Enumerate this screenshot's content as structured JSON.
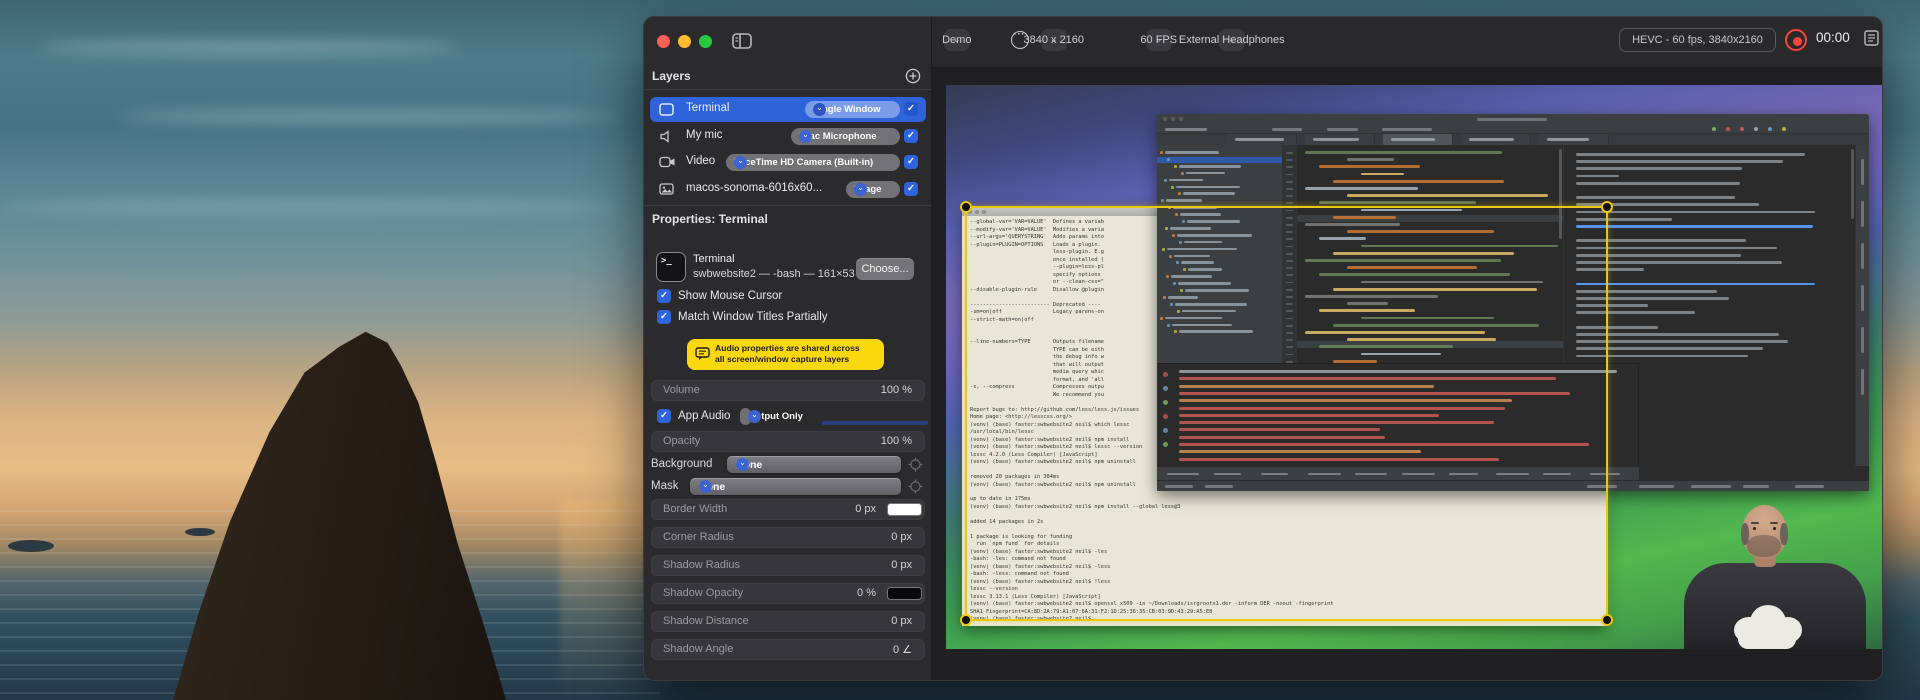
{
  "toolbar": {
    "preset": "Demo",
    "resolution": "3840 x 2160",
    "framerate": "60 FPS",
    "audio_device": "External Headphones",
    "format_info": "HEVC - 60 fps, 3840x2160",
    "timer": "00:00"
  },
  "layers_panel": {
    "title": "Layers",
    "rows": [
      {
        "name": "Terminal",
        "source": "Single Window",
        "icon": "window-icon",
        "selected": true,
        "enabled": true
      },
      {
        "name": "My mic",
        "source": "iMac Microphone",
        "icon": "speaker-icon",
        "selected": false,
        "enabled": true
      },
      {
        "name": "Video",
        "source": "FaceTime HD Camera (Built-in)",
        "icon": "camera-icon",
        "selected": false,
        "enabled": true
      },
      {
        "name": "macos-sonoma-6016x60...",
        "source": "Image",
        "icon": "image-icon",
        "selected": false,
        "enabled": true
      }
    ]
  },
  "properties": {
    "title": "Properties: Terminal",
    "app_name": "Terminal",
    "window_title": "swbwebsite2 — -bash — 161×53",
    "choose": "Choose...",
    "show_mouse_cursor": "Show Mouse Cursor",
    "match_window_titles": "Match Window Titles Partially",
    "notice_line1": "Audio properties are shared across",
    "notice_line2": "all screen/window capture layers",
    "volume_label": "Volume",
    "volume_value": "100 %",
    "app_audio_label": "App Audio",
    "app_audio_mode": "Output Only",
    "opacity_label": "Opacity",
    "opacity_value": "100 %",
    "background_label": "Background",
    "background_value": "None",
    "mask_label": "Mask",
    "mask_value": "None",
    "adjust_rows": [
      {
        "label": "Border Width",
        "value": "0 px",
        "swatch": "#ffffff"
      },
      {
        "label": "Corner Radius",
        "value": "0 px"
      },
      {
        "label": "Shadow Radius",
        "value": "0 px"
      },
      {
        "label": "Shadow Opacity",
        "value": "0 %",
        "swatch": "#0a0a0c"
      },
      {
        "label": "Shadow Distance",
        "value": "0 px"
      },
      {
        "label": "Shadow Angle",
        "value": "0",
        "icon": "angle"
      }
    ]
  },
  "preview": {
    "terminal_help_lines": [
      "--global-var='VAR=VALUE'  Defines a variab",
      "--modify-var='VAR=VALUE'  Modifies a varia",
      "--url-args='QUERYSTRING'  Adds params into",
      "--plugin=PLUGIN=OPTIONS   Loads a plugin. ",
      "                          less-plugin. E.g",
      "                          once installed (",
      "                          --plugin=less-pl",
      "                          specify options ",
      "                          or --clean-css=\"",
      "--disable-plugin-rule     Disallow @plugin",
      "",
      "------------------------- Deprecated ----",
      "-sm=on|off                Legacy parens-on",
      "--strict-math=on|off",
      "",
      "",
      "--line-numbers=TYPE       Outputs filename",
      "                          TYPE can be eith",
      "                          the debug info w",
      "                          that will output",
      "                          media query whic",
      "                          format, and 'all",
      "-x, --compress            Compresses outpu",
      "                          We recommend you",
      "",
      "Report bugs to: http://github.com/less/less.js/issues",
      "Home page: <http://lesscss.org/>",
      "(venv) (base) faster:swbwebsite2 neil$ which lessc",
      "/usr/local/bin/lessc",
      "(venv) (base) faster:swbwebsite2 neil$ npm install",
      "(venv) (base) faster:swbwebsite2 neil$ lessc --version",
      "lessc 4.2.0 (Less Compiler) [JavaScript]",
      "(venv) (base) faster:swbwebsite2 neil$ npm uninstall",
      "",
      "removed 20 packages in 304ms",
      "(venv) (base) faster:swbwebsite2 neil$ npm uninstall"
    ],
    "terminal_session_lines": [
      "up to date in 175ms",
      "(venv) (base) faster:swbwebsite2 neil$ npm install --global less@3",
      "",
      "added 14 packages in 2s",
      "",
      "1 package is looking for funding",
      "  run `npm fund` for details",
      "(venv) (base) faster:swbwebsite2 neil$ -les",
      "-bash: -les: command not found",
      "(venv) (base) faster:swbwebsite2 neil$ -less",
      "-bash: -less: command not found",
      "(venv) (base) faster:swbwebsite2 neil$ !less",
      "lessc --version",
      "lessc 3.13.1 (Less Compiler) [JavaScript]",
      "(venv) (base) faster:swbwebsite2 neil$ openssl x509 -in ~/Downloads/isrgrootx1.der -inform DER -noout -fingerprint",
      "SHA1 Fingerprint=CA:8D:2A:79:A1:07:6A:31:F2:1D:25:36:35:CB:03:9D:43:29:A5:E8",
      "(venv) (base) faster:swbwebsite2 neil$"
    ]
  },
  "colors": {
    "accent_blue": "#2e65de",
    "layer_selected_blue": "#2e63da",
    "pill_gray": "#717176",
    "pill_blue": "#7b9ce8",
    "notice_yellow": "#fbd70e",
    "selection_yellow": "#eec70f",
    "record_red": "#fb4538",
    "terminal_beige": "#e8e6d7"
  }
}
